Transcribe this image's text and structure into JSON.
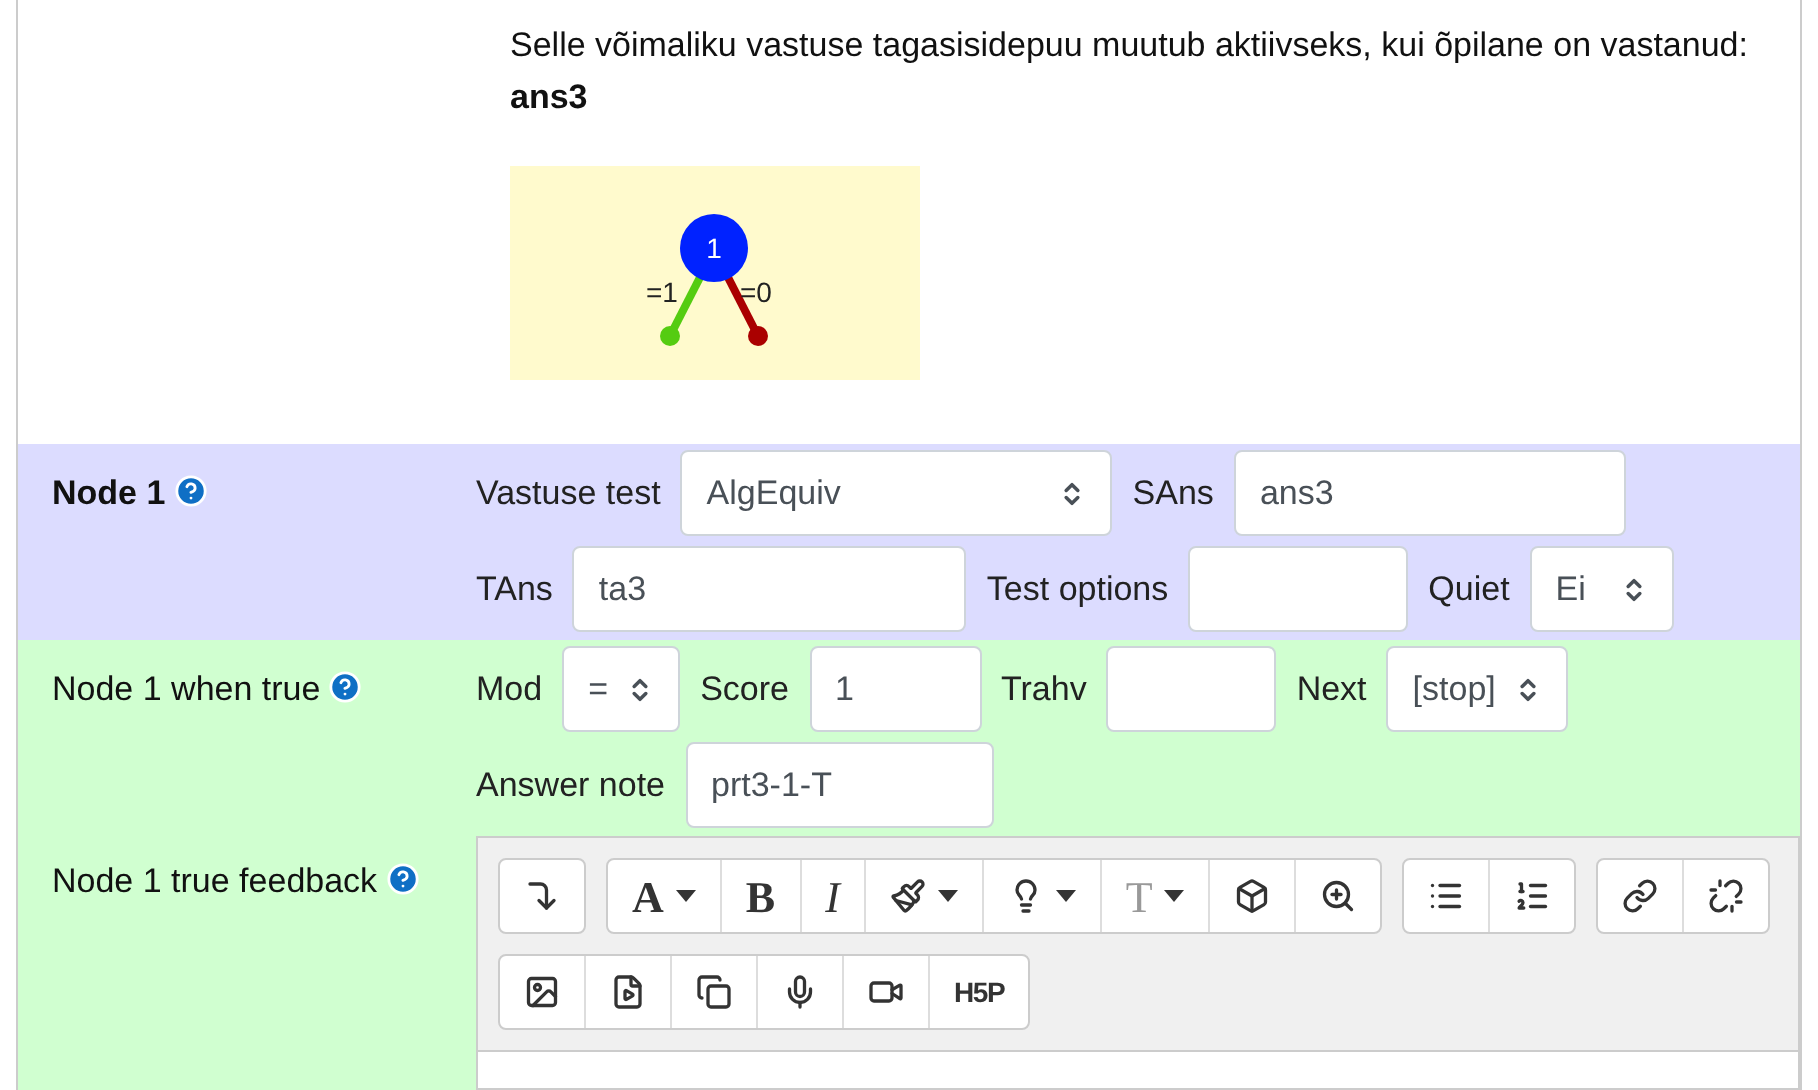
{
  "intro": {
    "text": "Selle võimaliku vastuse tagasisidepuu muutub aktiivseks, kui õpilane on vastanud:",
    "answer": "ans3"
  },
  "tree": {
    "node": "1",
    "branches": [
      {
        "label": "=1",
        "color": "#55cc11"
      },
      {
        "label": "=0",
        "color": "#aa0000"
      }
    ]
  },
  "sections": [
    {
      "title": "Node 1",
      "bold": true,
      "help": true,
      "color": "#dcdcff",
      "rows": [
        [
          {
            "label": "Vastuse test",
            "kind": "select",
            "value": "AlgEquiv"
          },
          {
            "label": "SAns",
            "kind": "input",
            "value": "ans3"
          }
        ],
        [
          {
            "label": "TAns",
            "kind": "input",
            "value": "ta3"
          },
          {
            "label": "Test options",
            "kind": "input"
          },
          {
            "label": "Quiet",
            "kind": "select",
            "value": "Ei"
          }
        ]
      ]
    },
    {
      "title": "Node 1 when true",
      "bold": false,
      "help": true,
      "color": "#d0ffd0",
      "rows": [
        [
          {
            "label": "Mod",
            "kind": "select",
            "value": "="
          },
          {
            "label": "Score",
            "kind": "input",
            "value": "1"
          },
          {
            "label": "Trahv",
            "kind": "input"
          },
          {
            "label": "Next",
            "kind": "select",
            "value": "[stop]"
          }
        ],
        [
          {
            "label": "Answer note",
            "kind": "input",
            "value": "prt3-1-T"
          }
        ]
      ],
      "editor": {
        "title": "Node 1 true feedback",
        "help": true,
        "toolbar": [
          [
            [
              {
                "kind": "indent"
              }
            ],
            [
              {
                "kind": "font",
                "text": "A",
                "caret": true
              },
              {
                "kind": "bold",
                "text": "B"
              },
              {
                "kind": "italic",
                "text": "I"
              },
              {
                "kind": "brush",
                "caret": true
              },
              {
                "kind": "bulb",
                "caret": true
              },
              {
                "kind": "size",
                "text": "T",
                "caret": true,
                "disabled": true
              },
              {
                "kind": "cube"
              },
              {
                "kind": "zoom"
              }
            ],
            [
              {
                "kind": "bullets"
              },
              {
                "kind": "numbers"
              }
            ],
            [
              {
                "kind": "link"
              },
              {
                "kind": "unlink"
              }
            ]
          ],
          [
            [
              {
                "kind": "image"
              },
              {
                "kind": "media"
              },
              {
                "kind": "copy"
              },
              {
                "kind": "mic"
              },
              {
                "kind": "video"
              },
              {
                "kind": "h5p",
                "text": "H5P"
              }
            ]
          ]
        ]
      }
    }
  ]
}
